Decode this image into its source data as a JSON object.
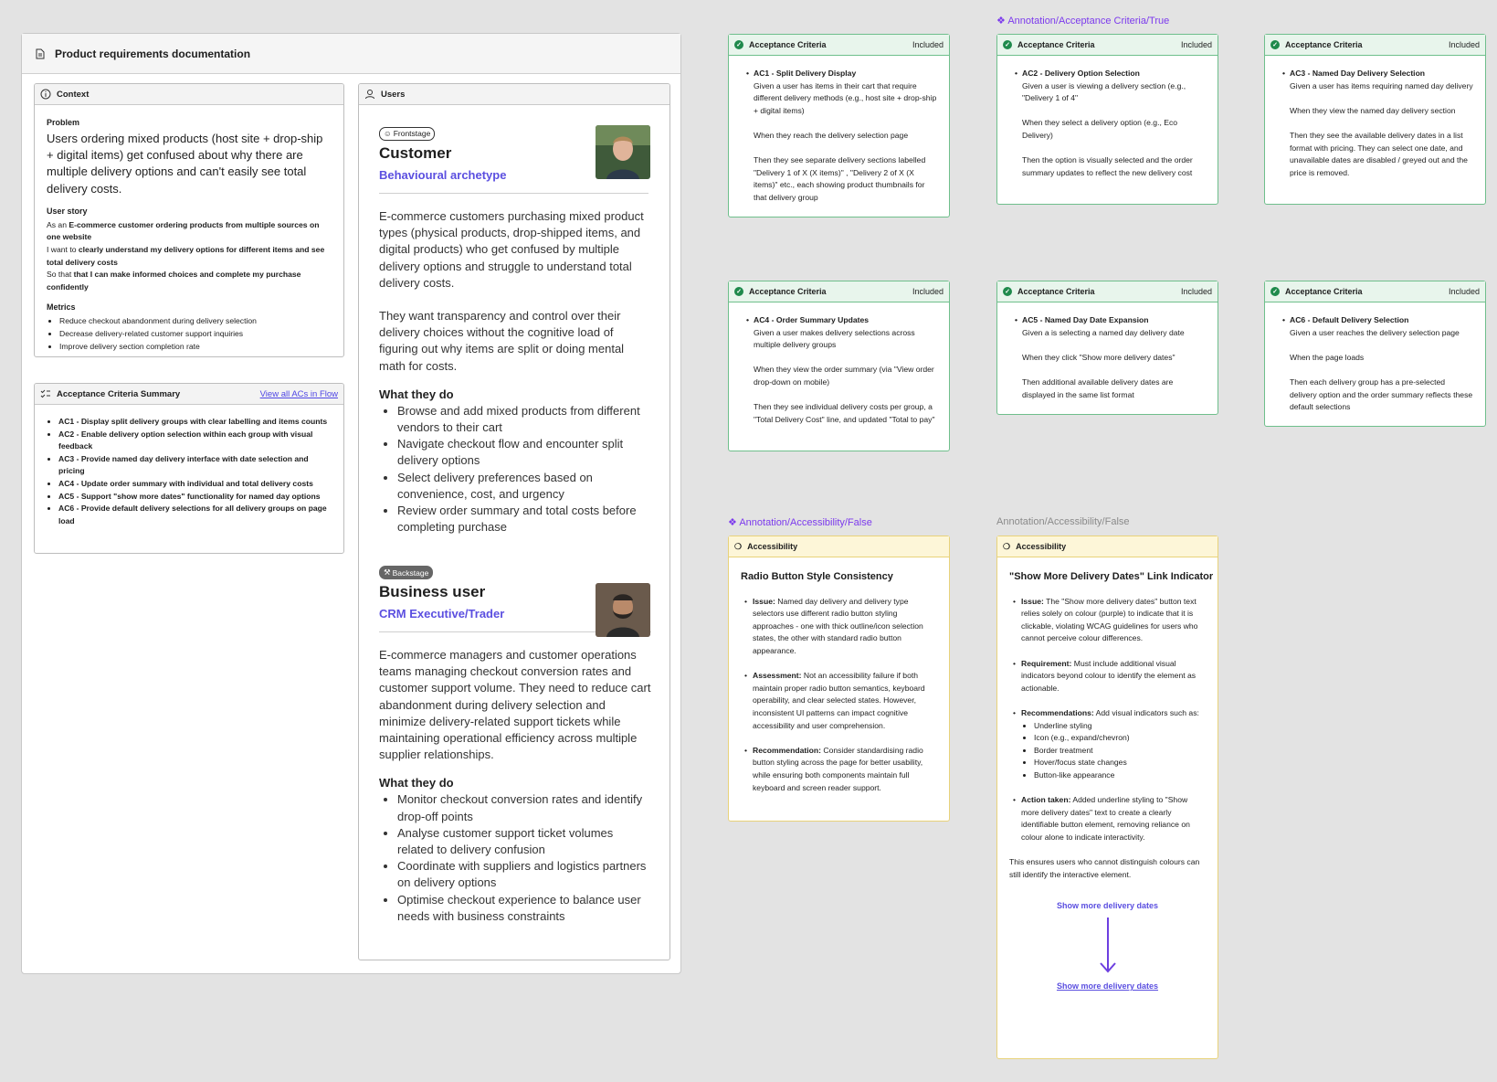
{
  "prd": {
    "title": "Product requirements documentation",
    "context": {
      "header": "Context",
      "problem_label": "Problem",
      "problem_text": "Users ordering mixed products (host site + drop-ship + digital items) get confused about why there are multiple delivery options and can't easily see total delivery costs.",
      "story_label": "User story",
      "story": [
        {
          "prefix": "As an ",
          "bold": "E-commerce customer ordering products from multiple sources on one website"
        },
        {
          "prefix": "I want to ",
          "bold": "clearly understand my delivery options for different items and see total delivery costs"
        },
        {
          "prefix": "So that ",
          "bold": "that I can make informed choices and complete my purchase confidently"
        }
      ],
      "metrics_label": "Metrics",
      "metrics": [
        "Reduce checkout abandonment during delivery selection",
        "Decrease delivery-related customer support inquiries",
        "Improve delivery section completion rate"
      ]
    },
    "ac_summary": {
      "header": "Acceptance Criteria Summary",
      "link": "View all ACs in Flow",
      "items": [
        "AC1 - Display split delivery groups with clear labelling and items counts",
        "AC2 - Enable delivery option selection within each group with visual feedback",
        "AC3 - Provide named day delivery interface with date selection and pricing",
        "AC4 - Update order summary with individual and total delivery costs",
        "AC5 - Support \"show more dates\" functionality for named day options",
        "AC6 - Provide default delivery selections for all delivery groups on page load"
      ]
    },
    "users": {
      "header": "Users",
      "customer": {
        "tag": "Frontstage",
        "name": "Customer",
        "archetype": "Behavioural archetype",
        "para1": "E-commerce customers purchasing mixed product types (physical products, drop-shipped items, and digital products) who get confused by multiple delivery options and struggle to understand total delivery costs.",
        "para2": "They want transparency and control over their delivery choices without the cognitive load of figuring out why items are split or doing mental math for costs.",
        "what_label": "What they do",
        "what": [
          "Browse and add mixed products from different vendors to their cart",
          "Navigate checkout flow and encounter split delivery options",
          "Select delivery preferences based on convenience, cost, and urgency",
          "Review order summary and total costs before completing purchase"
        ]
      },
      "business": {
        "tag": "Backstage",
        "name": "Business user",
        "archetype": "CRM Executive/Trader",
        "para1": "E-commerce managers and customer operations teams managing checkout conversion rates and customer support volume. They need to reduce cart abandonment during delivery selection and minimize delivery-related support tickets while maintaining operational efficiency across multiple supplier relationships.",
        "what_label": "What they do",
        "what": [
          "Monitor checkout conversion rates and identify drop-off points",
          "Analyse customer support ticket volumes related to delivery confusion",
          "Coordinate with suppliers and logistics partners on delivery options",
          "Optimise checkout experience to balance user needs with business constraints"
        ]
      }
    }
  },
  "annotation_ac_label": "Annotation/Acceptance Criteria/True",
  "ac_cards": [
    {
      "header": "Acceptance Criteria",
      "status": "Included",
      "title": "AC1 - Split Delivery Display",
      "given": "Given a user has items in their cart that require different delivery methods (e.g., host site + drop-ship + digital items)",
      "when": "When they reach the delivery selection page",
      "then": "Then they see separate delivery sections labelled \"Delivery 1 of X (X items)\" , \"Delivery 2 of X (X items)\" etc., each showing product thumbnails for that delivery group"
    },
    {
      "header": "Acceptance Criteria",
      "status": "Included",
      "title": "AC2 - Delivery Option Selection",
      "given": "Given a user is viewing a delivery section (e.g., \"Delivery 1 of 4\"",
      "when": "When they select a delivery option (e.g., Eco Delivery)",
      "then": "Then the option is visually selected and the order summary updates to reflect the new delivery cost"
    },
    {
      "header": "Acceptance Criteria",
      "status": "Included",
      "title": "AC3 - Named Day Delivery Selection",
      "given": "Given a user has items requiring named day delivery",
      "when": "When they view the named day delivery section",
      "then": "Then they see the available delivery dates in a list format with pricing. They can select one date, and unavailable dates are disabled / greyed out and the price is removed."
    },
    {
      "header": "Acceptance Criteria",
      "status": "Included",
      "title": "AC4 - Order Summary Updates",
      "given": "Given a user makes delivery selections across multiple delivery groups",
      "when": "When they view the order summary (via \"View order drop-down on mobile)",
      "then": "Then they see individual delivery costs per group, a \"Total Delivery Cost\" line, and updated \"Total to pay\""
    },
    {
      "header": "Acceptance Criteria",
      "status": "Included",
      "title": "AC5 - Named Day Date Expansion",
      "given": "Given a is selecting a named day delivery date",
      "when": "When they click \"Show more delivery dates\"",
      "then": "Then additional available delivery dates are displayed in the same list format"
    },
    {
      "header": "Acceptance Criteria",
      "status": "Included",
      "title": "AC6 - Default Delivery Selection",
      "given": "Given a user reaches the delivery selection page",
      "when": "When the page loads",
      "then": "Then each delivery group has a pre-selected delivery option and the order summary reflects these default selections"
    }
  ],
  "annotation_acc_label_1": "Annotation/Accessibility/False",
  "annotation_acc_label_2": "Annotation/Accessibility/False",
  "acc1": {
    "header": "Accessibility",
    "title": "Radio Button Style Consistency",
    "issue_label": "Issue:",
    "issue": "Named day delivery and delivery type selectors use different radio button styling approaches - one with thick outline/icon selection states, the other with standard radio button appearance.",
    "assess_label": "Assessment:",
    "assess": "Not an accessibility failure if both maintain proper radio button semantics, keyboard operability, and clear selected states. However, inconsistent UI patterns can impact cognitive accessibility and user comprehension.",
    "rec_label": "Recommendation:",
    "rec": "Consider standardising radio button styling across the page for better usability, while ensuring both components maintain full keyboard and screen reader support."
  },
  "acc2": {
    "header": "Accessibility",
    "title": "\"Show More Delivery Dates\" Link Indicator",
    "issue_label": "Issue:",
    "issue": "The \"Show more delivery dates\" button text relies solely on colour (purple) to indicate that it is clickable, violating WCAG guidelines for users who cannot perceive colour differences.",
    "req_label": "Requirement:",
    "req": "Must include additional visual indicators beyond colour to identify the element as actionable.",
    "rec_label": "Recommendations:",
    "rec": "Add visual indicators such as:",
    "rec_items": [
      "Underline styling",
      "Icon (e.g., expand/chevron)",
      "Border treatment",
      "Hover/focus state changes",
      "Button-like appearance"
    ],
    "action_label": "Action taken:",
    "action": "Added underline styling to \"Show more delivery dates\" text to create a clearly identifiable button element, removing reliance on colour alone to indicate interactivity.",
    "ensures": "This ensures users who cannot distinguish colours can still identify the interactive element.",
    "before_link": "Show more delivery dates",
    "after_link": "Show more delivery dates"
  },
  "colors": {
    "accent": "#5b4fe0",
    "annotation": "#7c3aed",
    "ac_green": "#1f8a4c",
    "acc_yellow": "#fdf6d8"
  }
}
